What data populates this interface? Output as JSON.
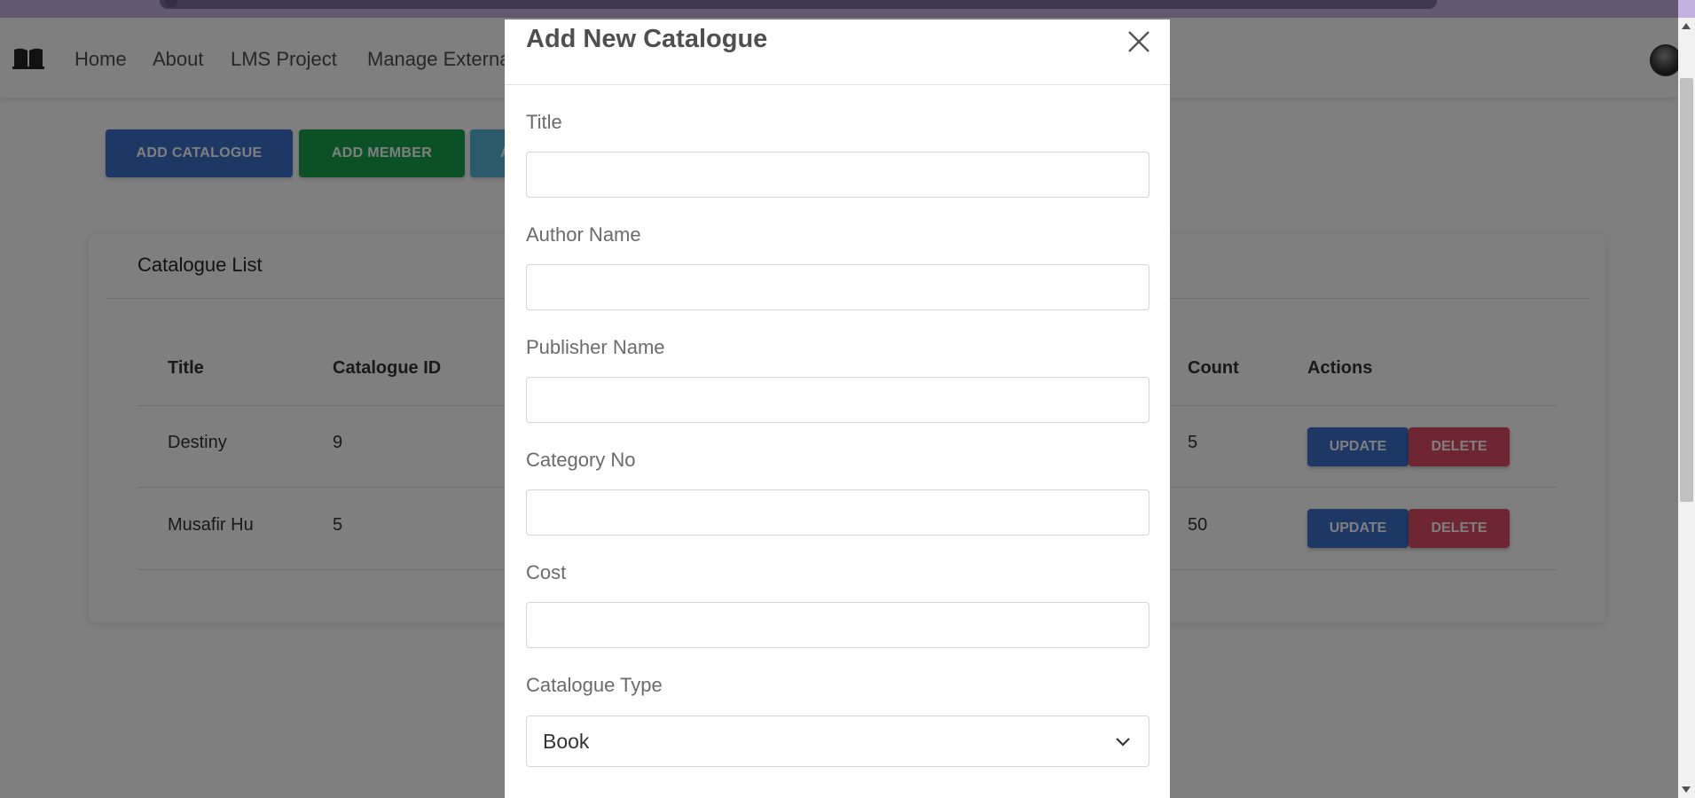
{
  "navbar": {
    "links": [
      "Home",
      "About",
      "LMS Project",
      "Manage External"
    ]
  },
  "actions": {
    "add_catalogue": "ADD CATALOGUE",
    "add_member": "ADD MEMBER",
    "third_button_partial": "A"
  },
  "catalogue_list": {
    "title": "Catalogue List",
    "columns": [
      "Title",
      "Catalogue ID",
      "Count",
      "Actions"
    ],
    "rows": [
      {
        "title": "Destiny",
        "catalogue_id": "9",
        "count": "5"
      },
      {
        "title": "Musafir Hu",
        "catalogue_id": "5",
        "count": "50"
      }
    ],
    "update_label": "UPDATE",
    "delete_label": "DELETE"
  },
  "modal": {
    "title": "Add New Catalogue",
    "fields": {
      "title": {
        "label": "Title",
        "value": ""
      },
      "author_name": {
        "label": "Author Name",
        "value": ""
      },
      "publisher_name": {
        "label": "Publisher Name",
        "value": ""
      },
      "category_no": {
        "label": "Category No",
        "value": ""
      },
      "cost": {
        "label": "Cost",
        "value": ""
      },
      "catalogue_type": {
        "label": "Catalogue Type",
        "value": "Book"
      }
    }
  },
  "colors": {
    "primary": "#3b71ca",
    "success": "#14a44d",
    "info": "#54b4d3",
    "danger": "#dc4c64",
    "browser_strip": "#c4b1e0"
  },
  "icons": {
    "brand": "book-open-icon",
    "close": "close-icon",
    "select": "chevron-down-icon",
    "avatar": "user-avatar"
  }
}
